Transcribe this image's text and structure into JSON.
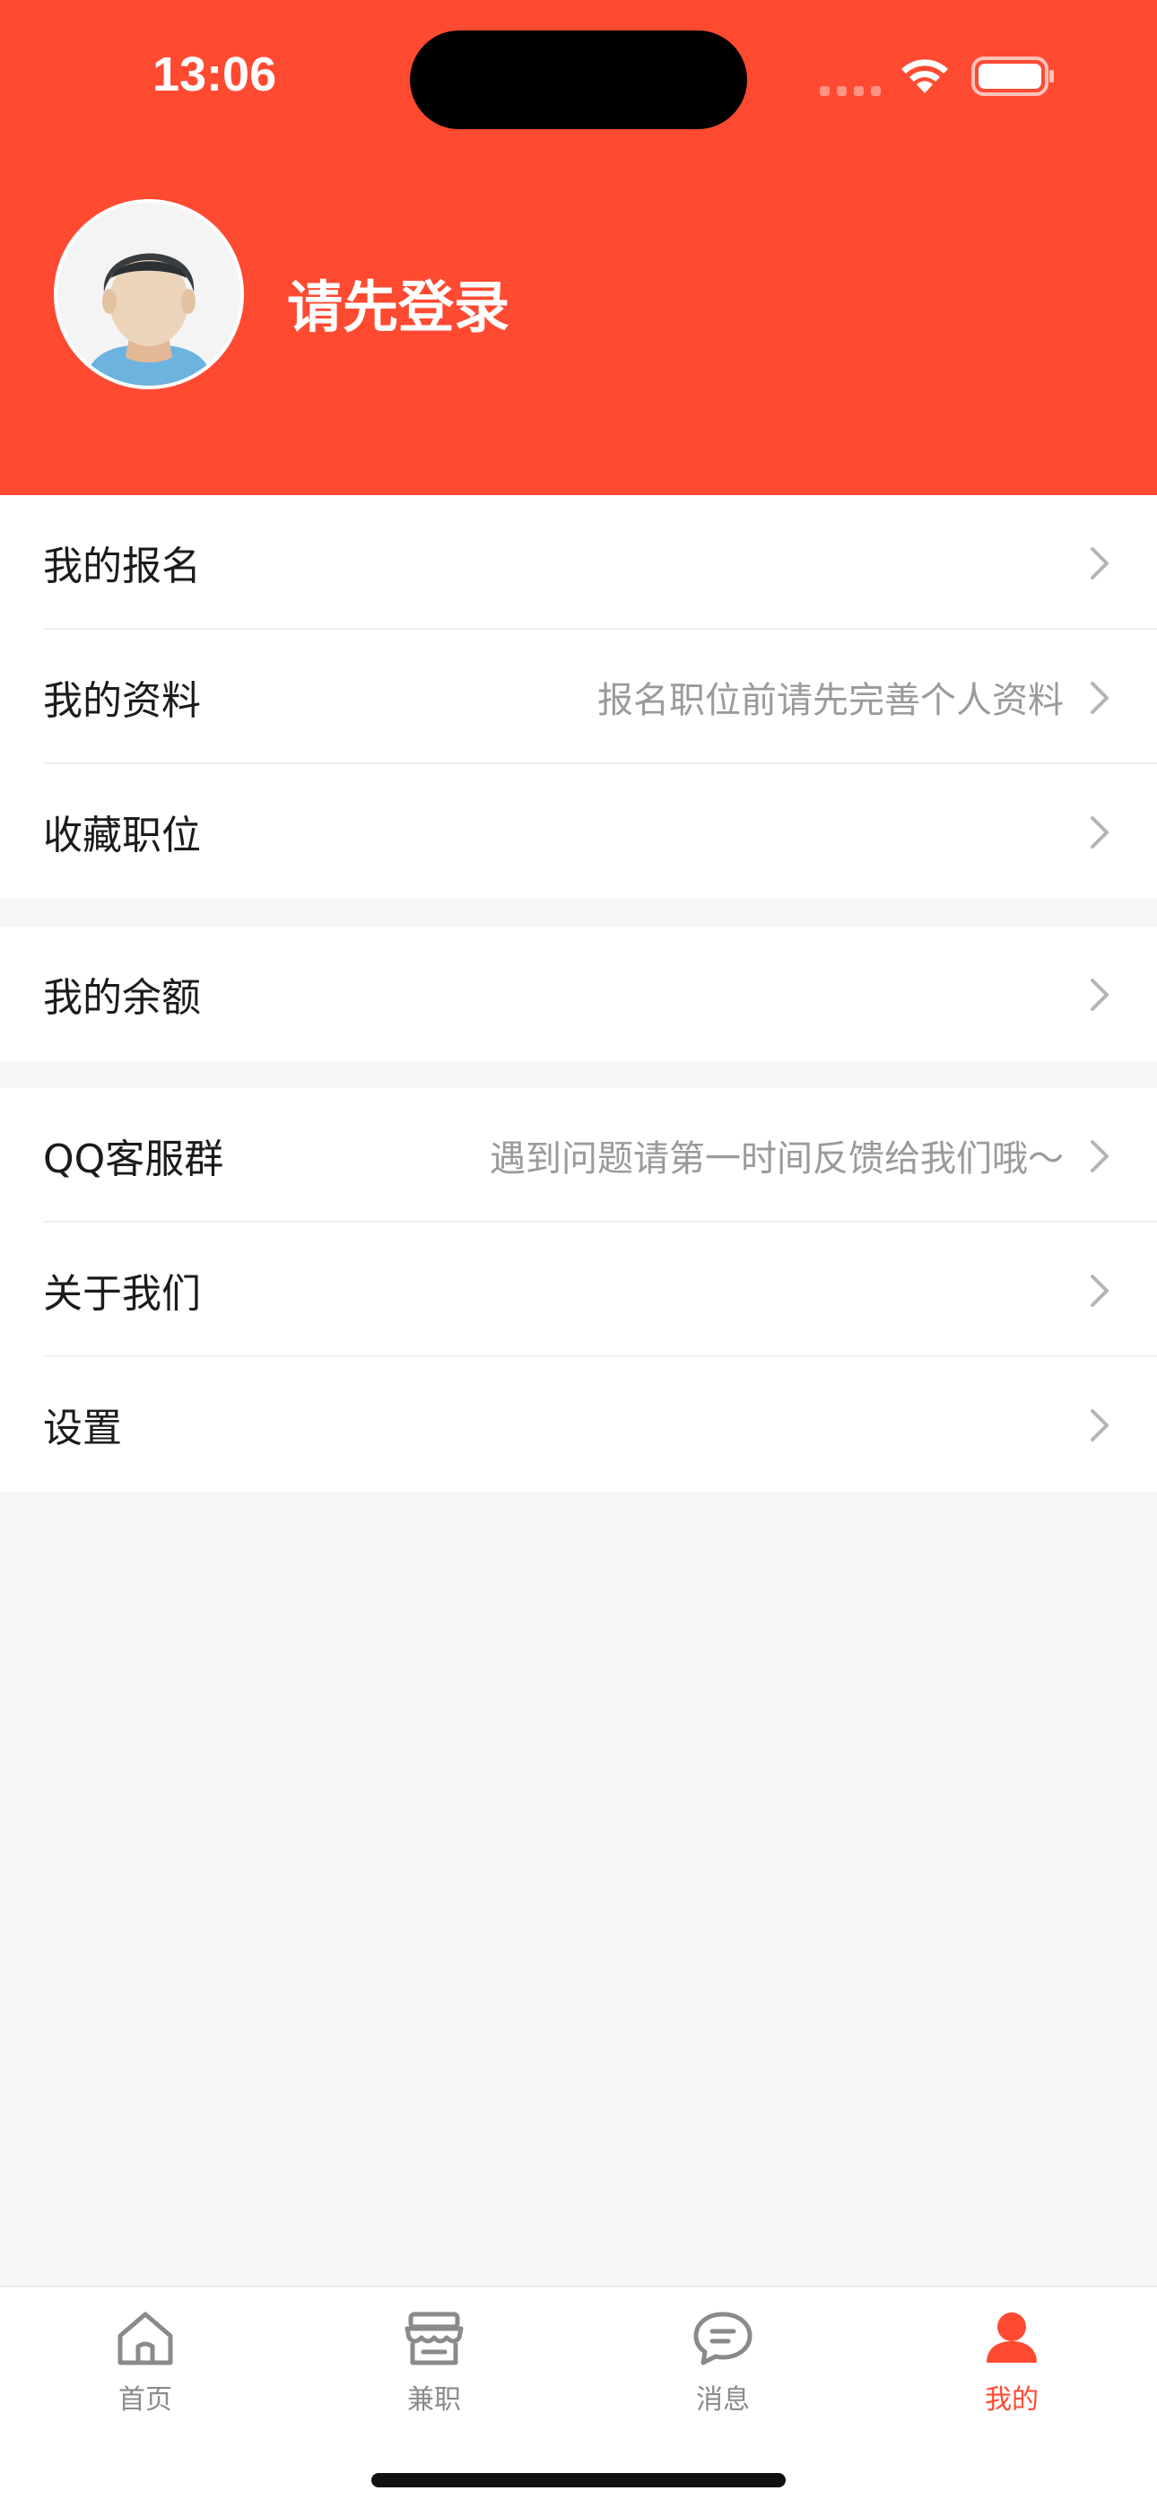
{
  "status_bar": {
    "time": "13:06"
  },
  "header": {
    "login_prompt": "请先登录"
  },
  "menu_groups": [
    [
      {
        "label": "我的报名",
        "hint": ""
      },
      {
        "label": "我的资料",
        "hint": "报名职位前请先完善个人资料"
      },
      {
        "label": "收藏职位",
        "hint": ""
      }
    ],
    [
      {
        "label": "我的余额",
        "hint": ""
      }
    ],
    [
      {
        "label": "QQ客服群",
        "hint": "遇到问题请第一时间反馈给我们哦～"
      },
      {
        "label": "关于我们",
        "hint": ""
      },
      {
        "label": "设置",
        "hint": ""
      }
    ]
  ],
  "tabbar": {
    "items": [
      {
        "label": "首页",
        "icon": "home-icon"
      },
      {
        "label": "兼职",
        "icon": "store-icon"
      },
      {
        "label": "消息",
        "icon": "chat-bubble-icon"
      },
      {
        "label": "我的",
        "icon": "person-icon"
      }
    ],
    "active_index": 3
  },
  "colors": {
    "accent": "#ff4a32",
    "background": "#f6f6f6"
  }
}
